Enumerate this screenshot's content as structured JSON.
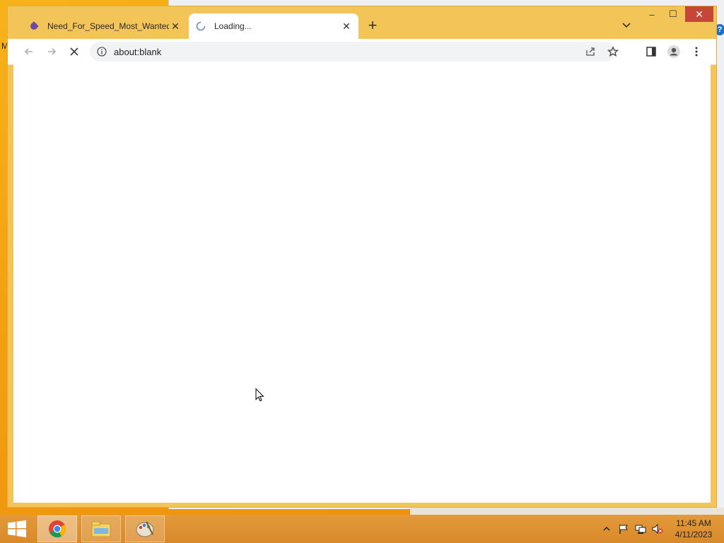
{
  "desktop": {
    "left_char": "M",
    "help_glyph": "?"
  },
  "browser": {
    "tabs": [
      {
        "title": "Need_For_Speed_Most_Wanted_",
        "favicon": "puzzle-icon",
        "active": false
      },
      {
        "title": "Loading...",
        "favicon": "loading-spinner-icon",
        "active": true
      }
    ],
    "new_tab_label": "+",
    "window_controls": {
      "minimize": "–",
      "maximize": "☐",
      "close": "✕"
    },
    "address_bar": {
      "url": "about:blank"
    }
  },
  "taskbar": {
    "apps": [
      "chrome-icon",
      "file-explorer-icon",
      "paint-icon"
    ],
    "clock": {
      "time": "11:45 AM",
      "date": "4/11/2023"
    }
  },
  "colors": {
    "desktop": "#f3a012",
    "window_frame": "#f3c558",
    "close_button": "#c7463a",
    "taskbar": "#dd9030"
  }
}
